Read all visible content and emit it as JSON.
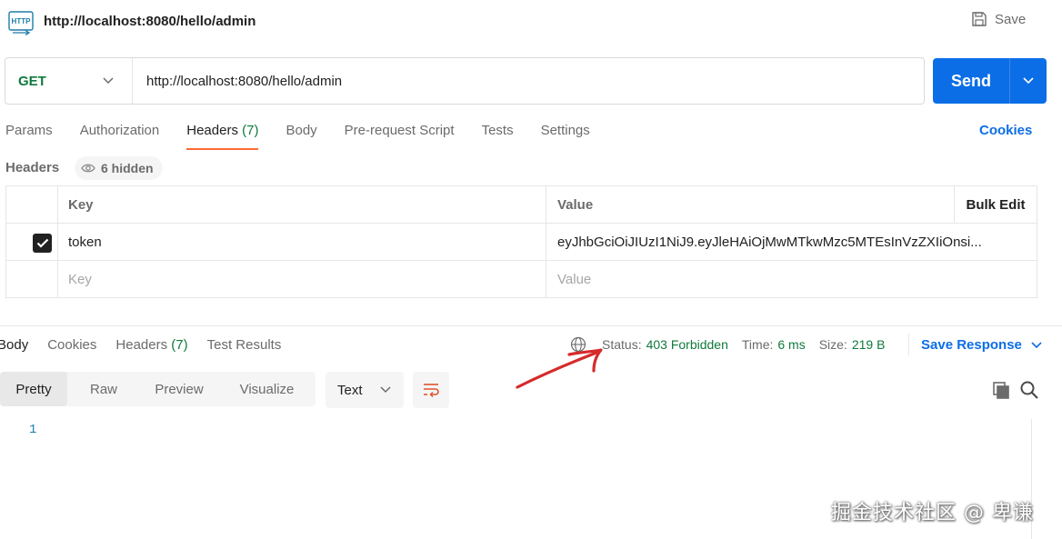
{
  "header": {
    "title": "http://localhost:8080/hello/admin",
    "save_label": "Save",
    "icon": "http-request-icon"
  },
  "request": {
    "method": "GET",
    "url": "http://localhost:8080/hello/admin",
    "send_label": "Send"
  },
  "request_tabs": {
    "params": "Params",
    "authorization": "Authorization",
    "headers": "Headers",
    "headers_count": "(7)",
    "body": "Body",
    "prerequest": "Pre-request Script",
    "tests": "Tests",
    "settings": "Settings",
    "active": "headers"
  },
  "cookies_link": "Cookies",
  "headers_section": {
    "label": "Headers",
    "hidden": "6 hidden",
    "columns": {
      "key": "Key",
      "value": "Value",
      "bulk_edit": "Bulk Edit"
    },
    "rows": [
      {
        "checked": true,
        "key": "token",
        "value": "eyJhbGciOiJIUzI1NiJ9.eyJleHAiOjMwMTkwMzc5MTEsInVzZXIiOnsi..."
      }
    ],
    "new_row": {
      "key_placeholder": "Key",
      "value_placeholder": "Value"
    }
  },
  "response_tabs": {
    "body": "Body",
    "cookies": "Cookies",
    "headers": "Headers",
    "headers_count": "(7)",
    "test_results": "Test Results",
    "active": "body"
  },
  "response_status": {
    "status_label": "Status:",
    "status_value": "403 Forbidden",
    "time_label": "Time:",
    "time_value": "6 ms",
    "size_label": "Size:",
    "size_value": "219 B",
    "save_response": "Save Response"
  },
  "format": {
    "pretty": "Pretty",
    "raw": "Raw",
    "preview": "Preview",
    "visualize": "Visualize",
    "active": "pretty",
    "type_select": "Text"
  },
  "response_body": {
    "line_number": "1"
  },
  "watermark": "掘金技术社区 @ 卑谦",
  "colors": {
    "accent": "#0c6ee6",
    "success": "#0f7a3d",
    "tab_underline": "#ff6c37",
    "annotation": "#d62a2a"
  }
}
